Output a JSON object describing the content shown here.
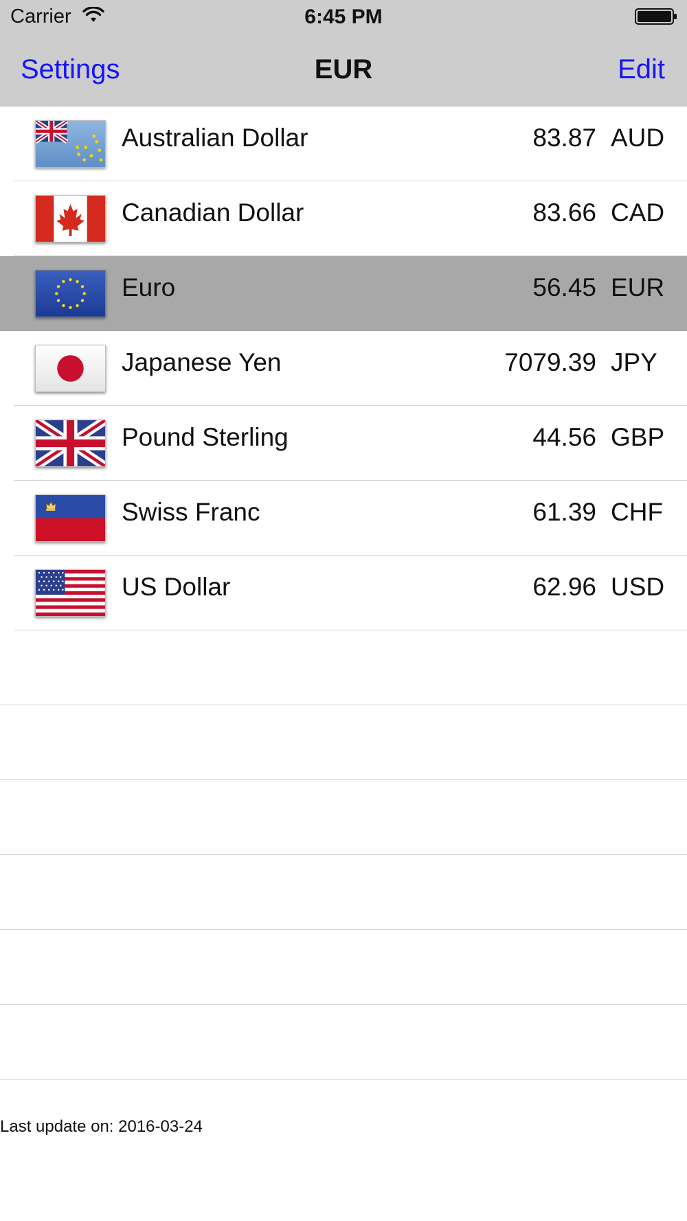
{
  "status_bar": {
    "carrier": "Carrier",
    "time": "6:45 PM"
  },
  "nav": {
    "left_label": "Settings",
    "title": "EUR",
    "right_label": "Edit",
    "link_color": "#1414ff"
  },
  "currencies": [
    {
      "name": "Australian Dollar",
      "value": "83.87",
      "code": "AUD",
      "flag": "australia-flag-icon"
    },
    {
      "name": "Canadian Dollar",
      "value": "83.66",
      "code": "CAD",
      "flag": "canada-flag-icon"
    },
    {
      "name": "Euro",
      "value": "56.45",
      "code": "EUR",
      "flag": "eu-flag-icon",
      "selected": true
    },
    {
      "name": "Japanese Yen",
      "value": "7079.39",
      "code": "JPY",
      "flag": "japan-flag-icon"
    },
    {
      "name": "Pound Sterling",
      "value": "44.56",
      "code": "GBP",
      "flag": "uk-flag-icon"
    },
    {
      "name": "Swiss Franc",
      "value": "61.39",
      "code": "CHF",
      "flag": "liechtenstein-flag-icon"
    },
    {
      "name": "US Dollar",
      "value": "62.96",
      "code": "USD",
      "flag": "us-flag-icon"
    }
  ],
  "footer": {
    "last_update": "Last update on: 2016-03-24"
  },
  "colors": {
    "header_bg": "#cdcdcd",
    "selected_row_bg": "#a8a8a8"
  }
}
